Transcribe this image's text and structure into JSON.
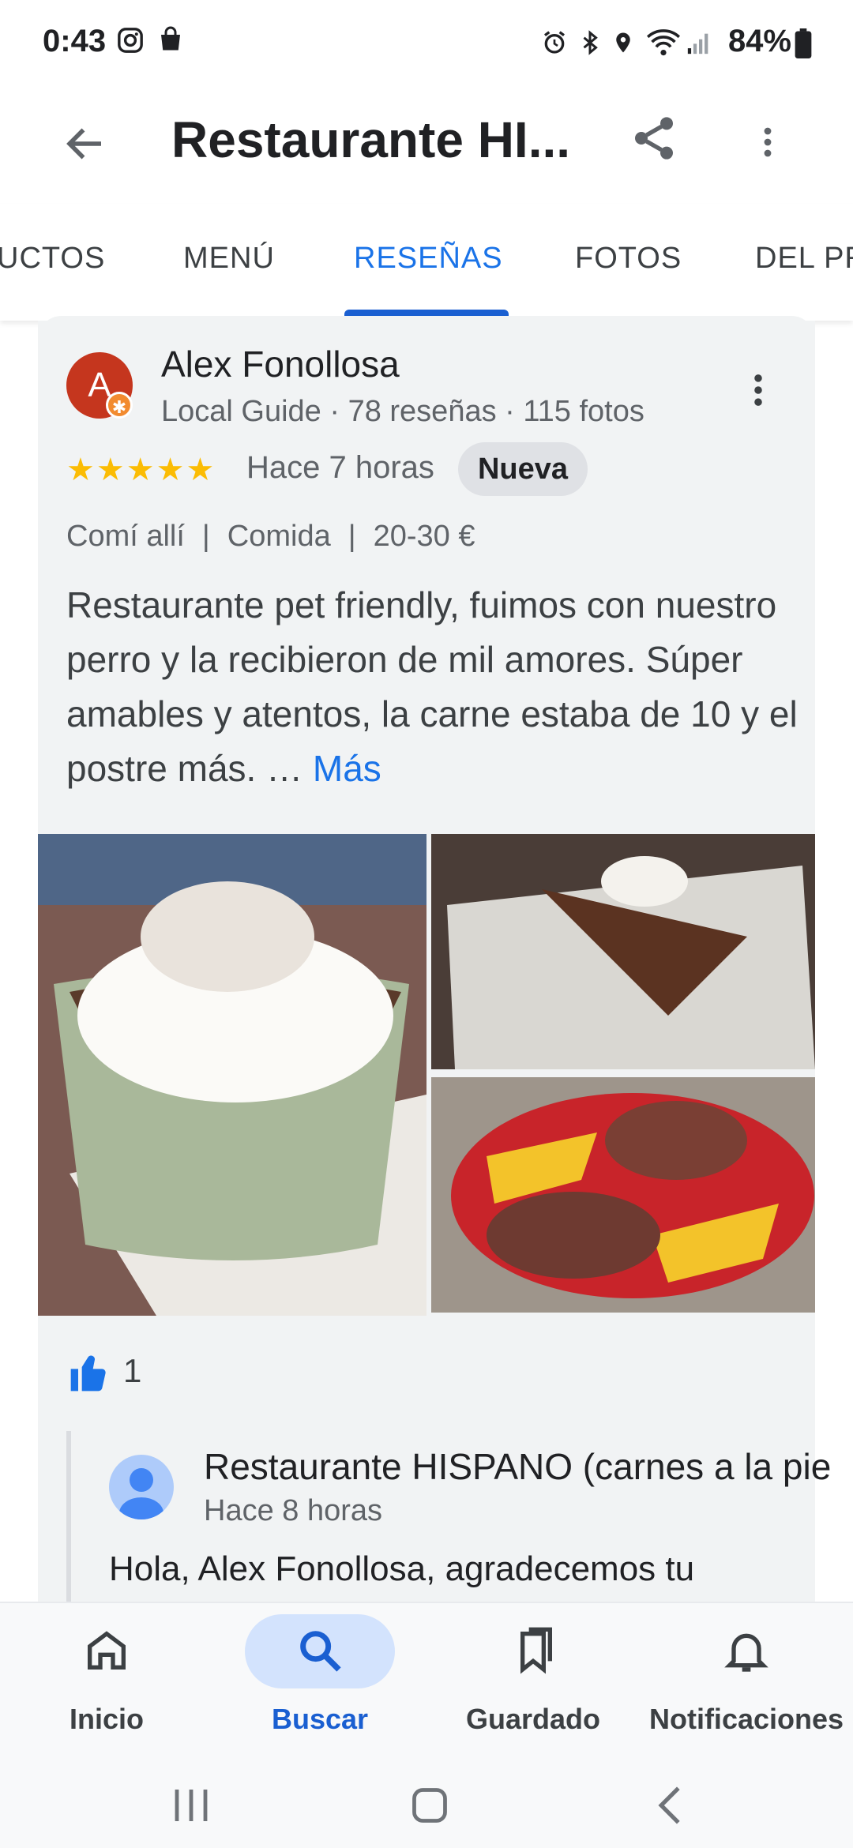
{
  "status_bar": {
    "time": "0:43",
    "battery": "84%"
  },
  "app_bar": {
    "title": "Restaurante HI..."
  },
  "tabs": [
    {
      "label": "UCTOS"
    },
    {
      "label": "MENÚ"
    },
    {
      "label": "RESEÑAS"
    },
    {
      "label": "FOTOS"
    },
    {
      "label": "DEL PR"
    }
  ],
  "active_tab": "RESEÑAS",
  "review": {
    "avatar_letter": "A",
    "reviewer_name": "Alex Fonollosa",
    "reviewer_meta": "Local Guide · 78 reseñas · 115 fotos",
    "rating": 5,
    "stars": "★★★★★",
    "time_ago": "Hace 7 horas",
    "badge": "Nueva",
    "tags": [
      "Comí allí",
      "Comida",
      "20-30 €"
    ],
    "tag_separator": "|",
    "text": "Restaurante pet friendly, fuimos con nuestro perro y la recibieron de mil amores. Súper amables y atentos, la carne estaba de 10 y el postre más. …",
    "more_label": "Más",
    "likes": "1"
  },
  "owner_reply": {
    "name": "Restaurante HISPANO (carnes a la pie",
    "time_ago": "Hace 8 horas",
    "text": "Hola, Alex Fonollosa, agradecemos tu"
  },
  "bottom_nav": [
    {
      "label": "Inicio",
      "icon": "home-icon"
    },
    {
      "label": "Buscar",
      "icon": "search-icon"
    },
    {
      "label": "Guardado",
      "icon": "bookmarks-icon"
    },
    {
      "label": "Notificaciones",
      "icon": "bell-icon"
    }
  ],
  "active_nav": "Buscar",
  "colors": {
    "accent": "#1a73e8",
    "star": "#fbbc04",
    "avatar": "#c5361e",
    "card_bg": "#f1f3f4"
  }
}
